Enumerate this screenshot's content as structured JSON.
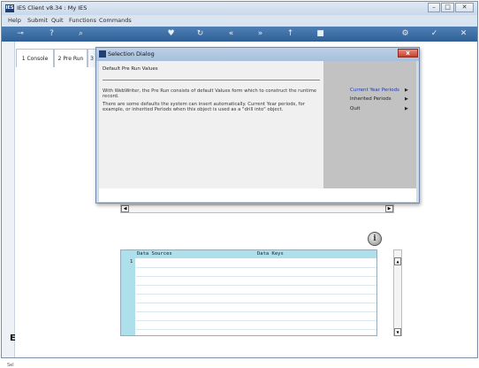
{
  "window": {
    "title": "IES Client v8.34 : My IES",
    "app_icon": "IES",
    "min": "–",
    "max": "□",
    "close": "✕"
  },
  "menu": [
    "Help",
    "Submit",
    "Quit",
    "Functions",
    "Commands"
  ],
  "toolbar": {
    "icons": [
      "key-icon",
      "help-icon",
      "search-icon",
      "heart-icon",
      "refresh-icon",
      "rewind-icon",
      "fast-forward-icon",
      "up-icon",
      "stop-icon",
      "settings-icon",
      "check-icon",
      "close-icon"
    ]
  },
  "tabs": [
    {
      "label": "1 Console"
    },
    {
      "label": "2 Pre Run"
    },
    {
      "label": "3"
    }
  ],
  "dialog": {
    "title": "Selection Dialog",
    "close": "x",
    "heading": "Default Pre Run Values",
    "paragraph1": "With WebWriter, the Pre Run consists of default Values form which to construct the runtime record.",
    "paragraph2": "There are some defaults the system can insert automatically. Current Year periods, for example, or inherited Periods when this object is used as a \"drill into\" object.",
    "options": [
      {
        "label": "Current Year Periods",
        "color": "#1f3aa8"
      },
      {
        "label": "Inherited Periods",
        "color": "#222222"
      },
      {
        "label": "Quit",
        "color": "#222222"
      }
    ],
    "option_arrow": "▶"
  },
  "hscroll": {
    "left": "◀",
    "right": "▶"
  },
  "info_icon": "i",
  "table": {
    "columns": [
      "Data Sources",
      "Data Keys"
    ],
    "rows": [
      "1"
    ]
  },
  "vscroll": {
    "up": "▲",
    "down": "▼"
  },
  "side": {
    "text": "Sel",
    "glyph": "E"
  }
}
